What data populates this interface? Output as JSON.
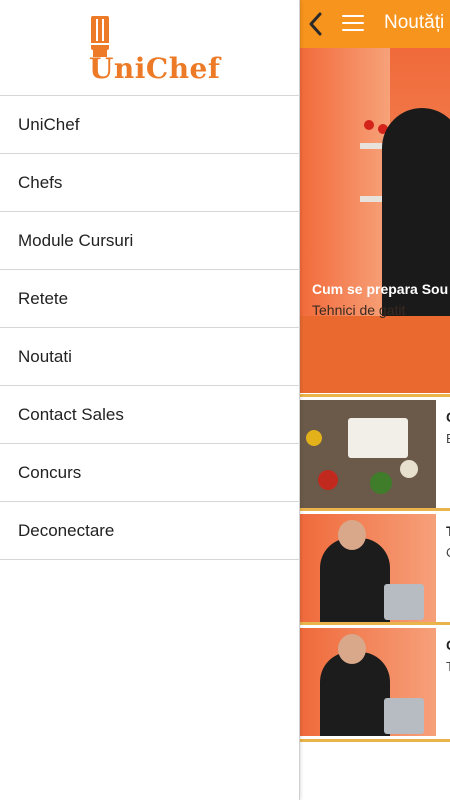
{
  "app": {
    "brand": "UniChef",
    "accent_color": "#f7941d"
  },
  "appbar": {
    "title": "Noutăți",
    "back_icon": "chevron-left-icon",
    "menu_icon": "hamburger-menu-icon"
  },
  "drawer": {
    "items": [
      {
        "label": "UniChef"
      },
      {
        "label": "Chefs"
      },
      {
        "label": "Module Cursuri"
      },
      {
        "label": "Retete"
      },
      {
        "label": "Noutati"
      },
      {
        "label": "Contact Sales"
      },
      {
        "label": "Concurs"
      },
      {
        "label": "Deconectare"
      }
    ]
  },
  "feed": {
    "hero": {
      "title": "Cum se prepara Sou",
      "subtitle": "Tehnici de gatit"
    },
    "cards": [
      {
        "title_fragment": "C",
        "subtitle_fragment": "E"
      },
      {
        "title_fragment": "T",
        "subtitle_fragment": "C"
      },
      {
        "title_fragment": "C",
        "subtitle_fragment": "T"
      }
    ]
  }
}
